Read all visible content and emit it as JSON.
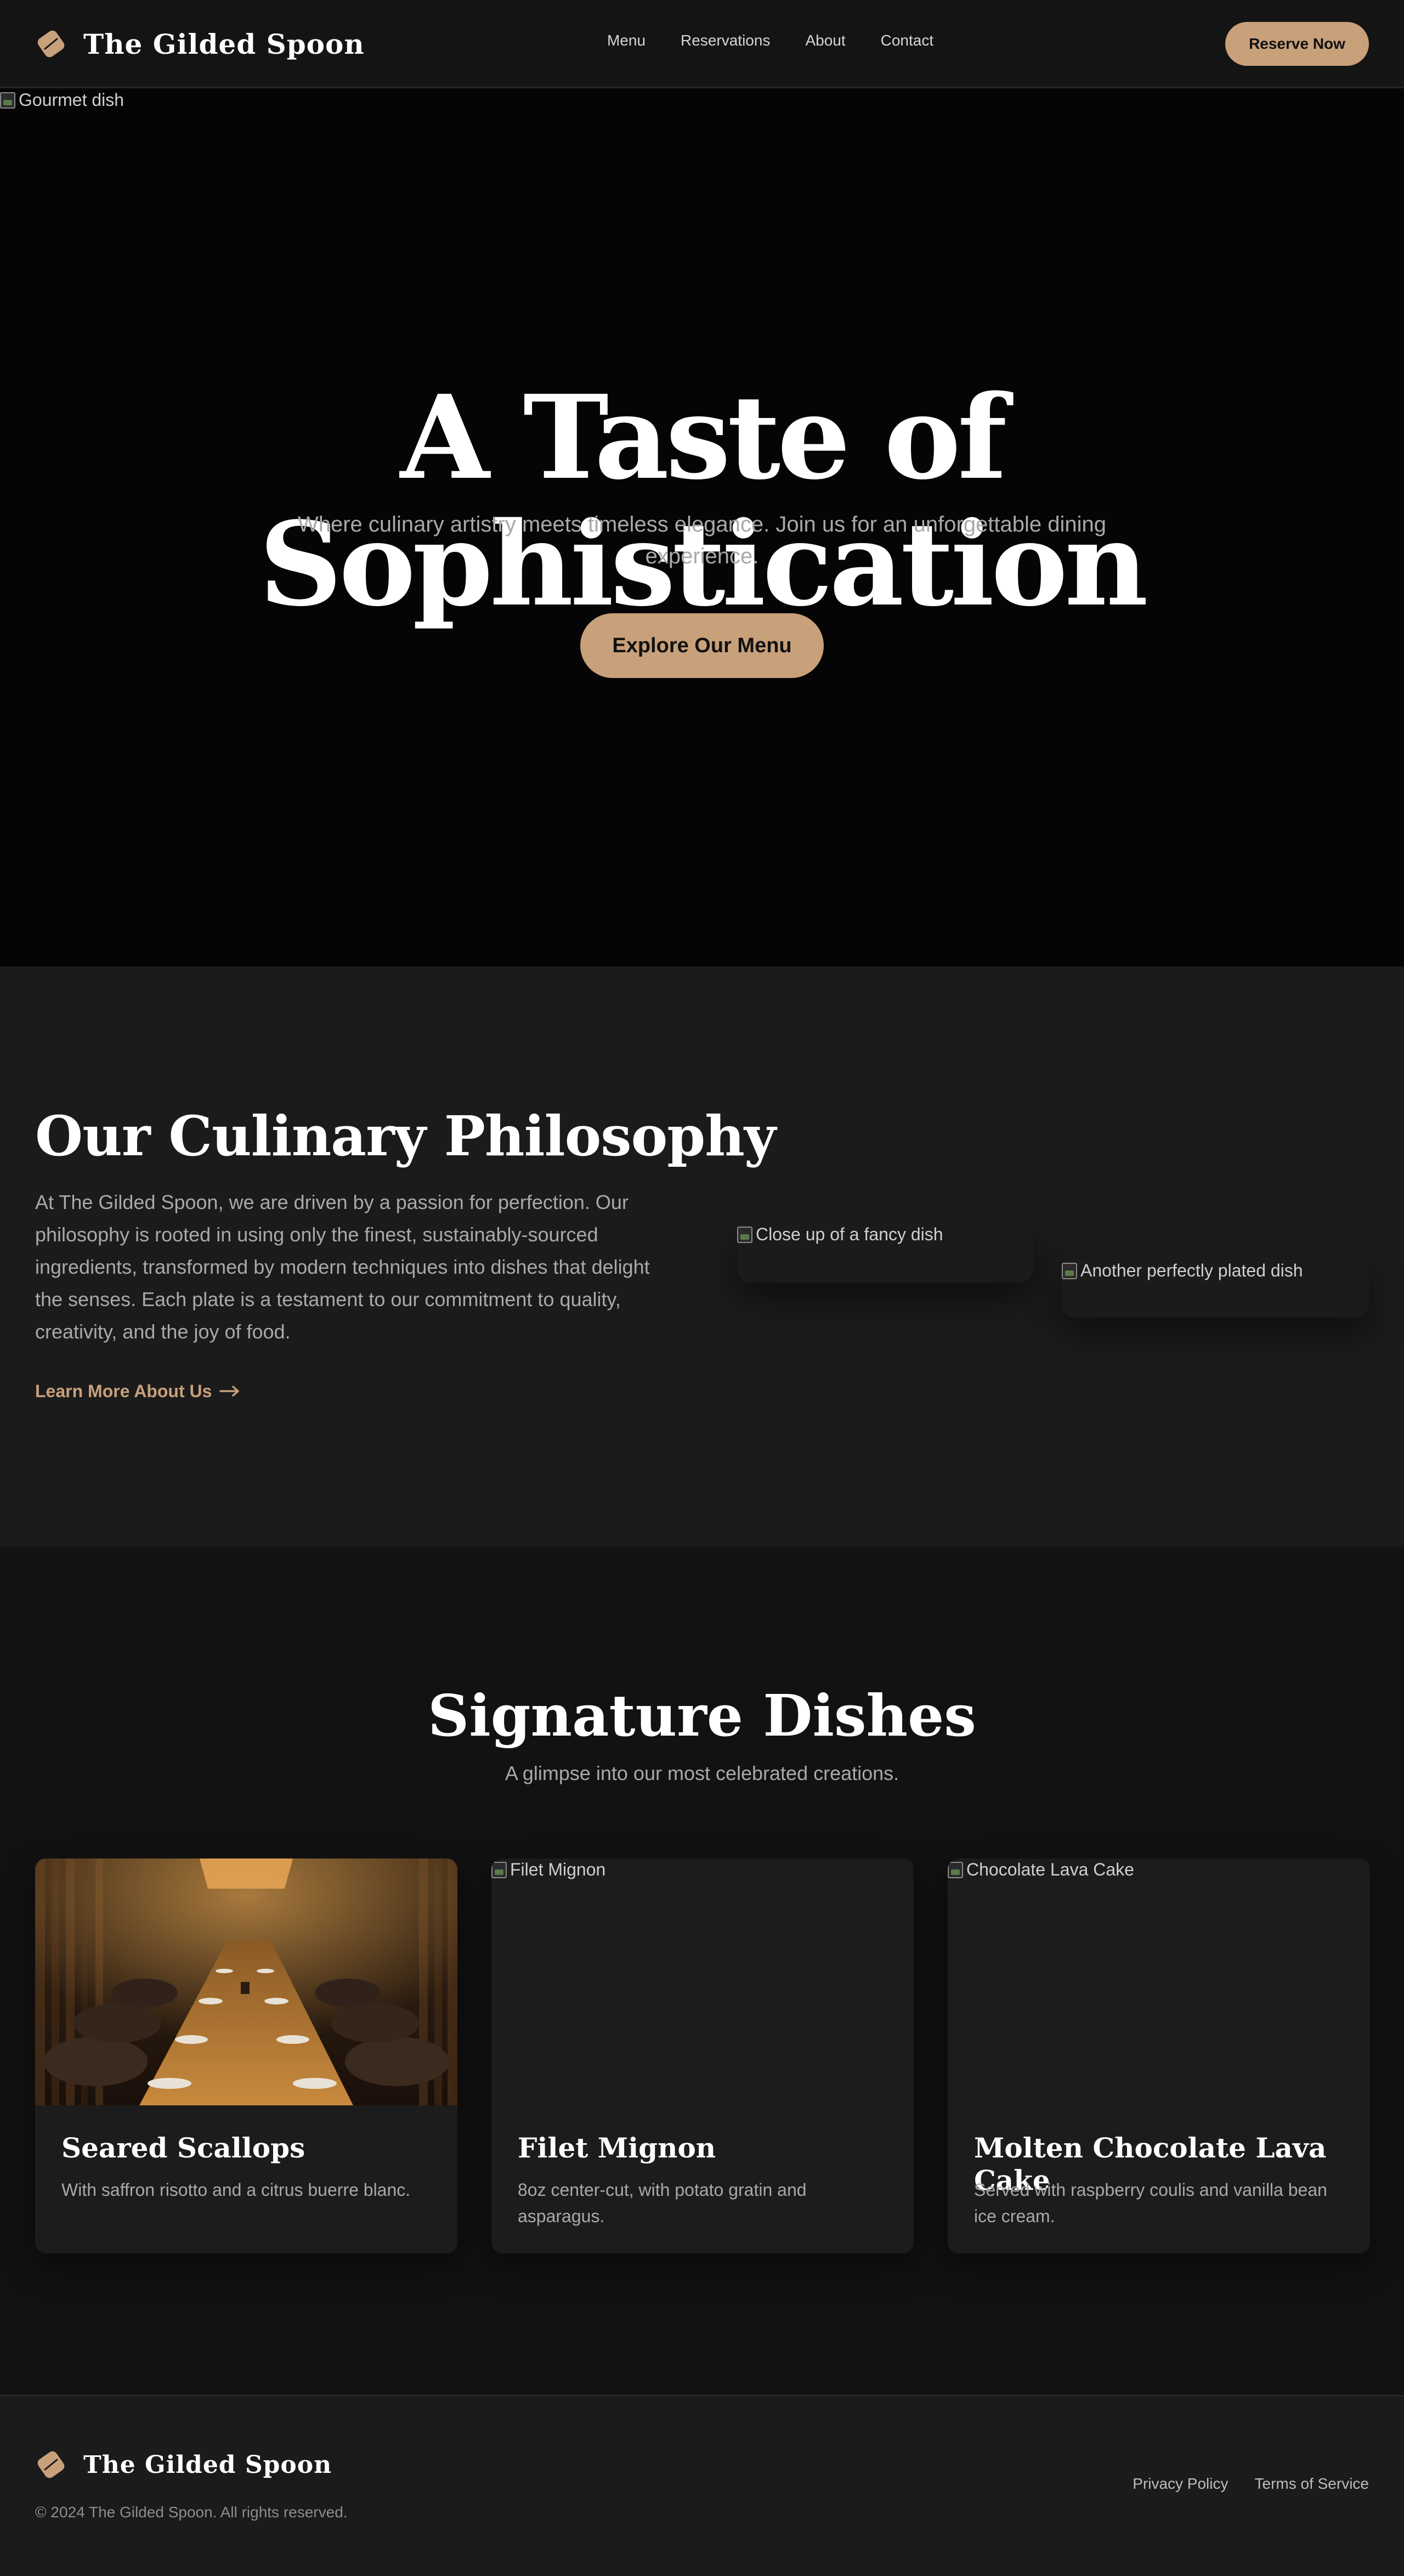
{
  "header": {
    "brand": "The Gilded Spoon",
    "nav": [
      "Menu",
      "Reservations",
      "About",
      "Contact"
    ],
    "reserve_label": "Reserve Now"
  },
  "hero": {
    "image_alt": "Gourmet dish",
    "title": "A Taste of Sophistication",
    "subtitle": "Where culinary artistry meets timeless elegance. Join us for an unforgettable dining experience.",
    "cta_label": "Explore Our Menu"
  },
  "philosophy": {
    "title": "Our Culinary Philosophy",
    "body": "At The Gilded Spoon, we are driven by a passion for perfection. Our philosophy is rooted in using only the finest, sustainably-sourced ingredients, transformed by modern techniques into dishes that delight the senses. Each plate is a testament to our commitment to quality, creativity, and the joy of food.",
    "link_label": "Learn More About Us",
    "image1_alt": "Close up of a fancy dish",
    "image2_alt": "Another perfectly plated dish"
  },
  "signature": {
    "title": "Signature Dishes",
    "subtitle": "A glimpse into our most celebrated creations.",
    "dishes": [
      {
        "title": "Seared Scallops",
        "desc": "With saffron risotto and a citrus buerre blanc.",
        "image_alt": ""
      },
      {
        "title": "Filet Mignon",
        "desc": "8oz center-cut, with potato gratin and asparagus.",
        "image_alt": "Filet Mignon"
      },
      {
        "title": "Molten Chocolate Lava Cake",
        "desc": "Served with raspberry coulis and vanilla bean ice cream.",
        "image_alt": "Chocolate Lava Cake"
      }
    ]
  },
  "footer": {
    "brand": "The Gilded Spoon",
    "copyright": "© 2024 The Gilded Spoon. All rights reserved.",
    "links": [
      "Privacy Policy",
      "Terms of Service"
    ]
  },
  "colors": {
    "accent": "#c8a07a",
    "background": "#121212",
    "surface": "#1b1b1b",
    "text_muted": "#a9a9a9"
  },
  "icons": {
    "logo": "spoon-logo-icon",
    "arrow": "arrow-right-icon",
    "broken_image": "broken-image-icon"
  }
}
